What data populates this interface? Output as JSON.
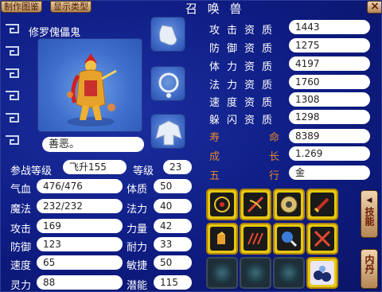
{
  "header": {
    "tab_illustrate": "制作图鉴",
    "tab_display_type": "显示类型",
    "title": "召 唤 兽",
    "close": "×"
  },
  "pet": {
    "name": "修罗傀儡鬼",
    "description": "善恶。"
  },
  "level_row": {
    "battle_level_label": "参战等级",
    "battle_level_value": "飞升155",
    "level_label": "等级",
    "level_value": "23"
  },
  "stats_left": [
    {
      "label": "气血",
      "value": "476/476"
    },
    {
      "label": "魔法",
      "value": "232/232"
    },
    {
      "label": "攻击",
      "value": "169"
    },
    {
      "label": "防御",
      "value": "123"
    },
    {
      "label": "速度",
      "value": "65"
    },
    {
      "label": "灵力",
      "value": "88"
    }
  ],
  "stats_mid": [
    {
      "label": "体质",
      "value": "50"
    },
    {
      "label": "法力",
      "value": "40"
    },
    {
      "label": "力量",
      "value": "42"
    },
    {
      "label": "耐力",
      "value": "33"
    },
    {
      "label": "敏捷",
      "value": "50"
    },
    {
      "label": "潜能",
      "value": "115"
    }
  ],
  "aptitudes": [
    {
      "label": "攻击资质",
      "value": "1443"
    },
    {
      "label": "防御资质",
      "value": "1275"
    },
    {
      "label": "体力资质",
      "value": "4197"
    },
    {
      "label": "法力资质",
      "value": "1760"
    },
    {
      "label": "速度资质",
      "value": "1308"
    },
    {
      "label": "躲闪资质",
      "value": "1298"
    }
  ],
  "growth": [
    {
      "label": "寿命",
      "value": "8389"
    },
    {
      "label": "成长",
      "value": "1.269"
    },
    {
      "label": "五行",
      "value": "金"
    }
  ],
  "side_buttons": {
    "skills": "技能",
    "neidan": "内丹"
  },
  "skills": [
    "summon-icon",
    "weapon-slash-icon",
    "gear-shield-icon",
    "sword-icon",
    "fist-icon",
    "claw-icon",
    "orb-icon",
    "crossed-swords-icon",
    "empty-slot-icon",
    "empty-slot-icon",
    "empty-slot-icon",
    "orbs-icon"
  ],
  "colors": {
    "window_bg": "#0c1a7a",
    "highlight_label": "#e3862a",
    "skill_gold": "#e6c812"
  }
}
